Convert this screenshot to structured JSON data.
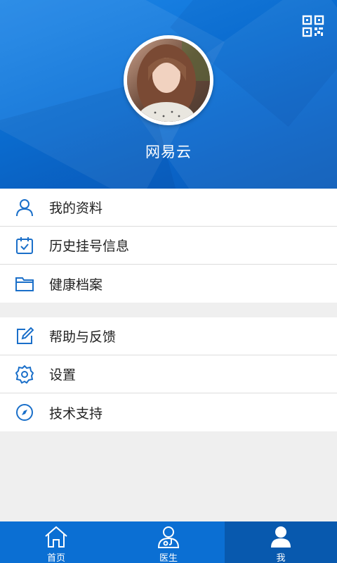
{
  "profile": {
    "username": "网易云"
  },
  "header": {
    "qr_icon": "qr-code-icon"
  },
  "menu_group_1": [
    {
      "label": "我的资料",
      "icon": "user-icon"
    },
    {
      "label": "历史挂号信息",
      "icon": "calendar-check-icon"
    },
    {
      "label": "健康档案",
      "icon": "folder-icon"
    }
  ],
  "menu_group_2": [
    {
      "label": "帮助与反馈",
      "icon": "edit-icon"
    },
    {
      "label": "设置",
      "icon": "gear-icon"
    },
    {
      "label": "技术支持",
      "icon": "compass-icon"
    }
  ],
  "tabbar": [
    {
      "label": "首页",
      "icon": "home-icon",
      "active": false
    },
    {
      "label": "医生",
      "icon": "doctor-icon",
      "active": false
    },
    {
      "label": "我",
      "icon": "me-icon",
      "active": true
    }
  ],
  "colors": {
    "accent": "#0b6fd3",
    "tab_active": "#0859ae",
    "icon": "#1a6fc9"
  }
}
